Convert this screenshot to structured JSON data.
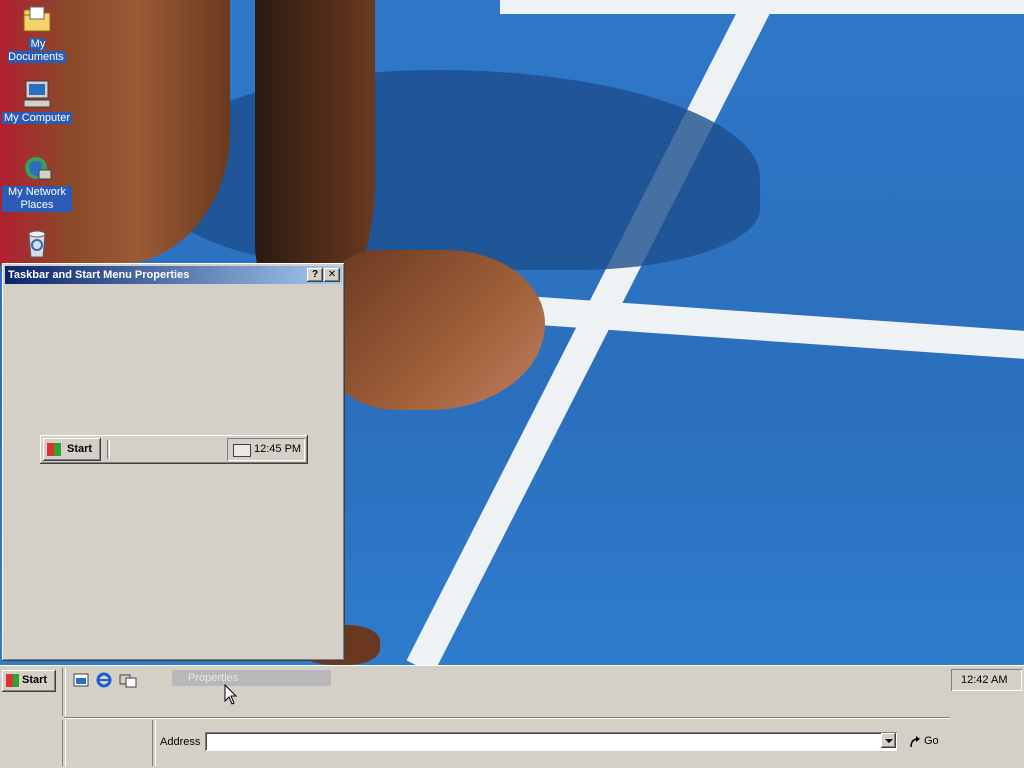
{
  "desktop": {
    "icons": [
      {
        "label": "My Documents",
        "icon": "folder-icon"
      },
      {
        "label": "My Computer",
        "icon": "computer-icon"
      },
      {
        "label": "My Network Places",
        "icon": "network-icon"
      },
      {
        "label": "",
        "icon": "recycle-bin-icon"
      }
    ]
  },
  "dialog": {
    "title": "Taskbar and Start Menu Properties",
    "help_label": "?",
    "close_label": "✕",
    "preview": {
      "start_label": "Start",
      "clock": "12:45 PM"
    }
  },
  "taskbar": {
    "start_label": "Start",
    "quick_launch": [
      "show-desktop-icon",
      "internet-explorer-icon",
      "desktop-switch-icon"
    ],
    "context_item": "Properties",
    "clock": "12:42 AM",
    "address_label": "Address",
    "address_value": "",
    "go_label": "Go"
  },
  "colors": {
    "window_face": "#d4d0c8",
    "title_active": "#0a246a",
    "wallpaper_blue": "#2f78c8"
  }
}
